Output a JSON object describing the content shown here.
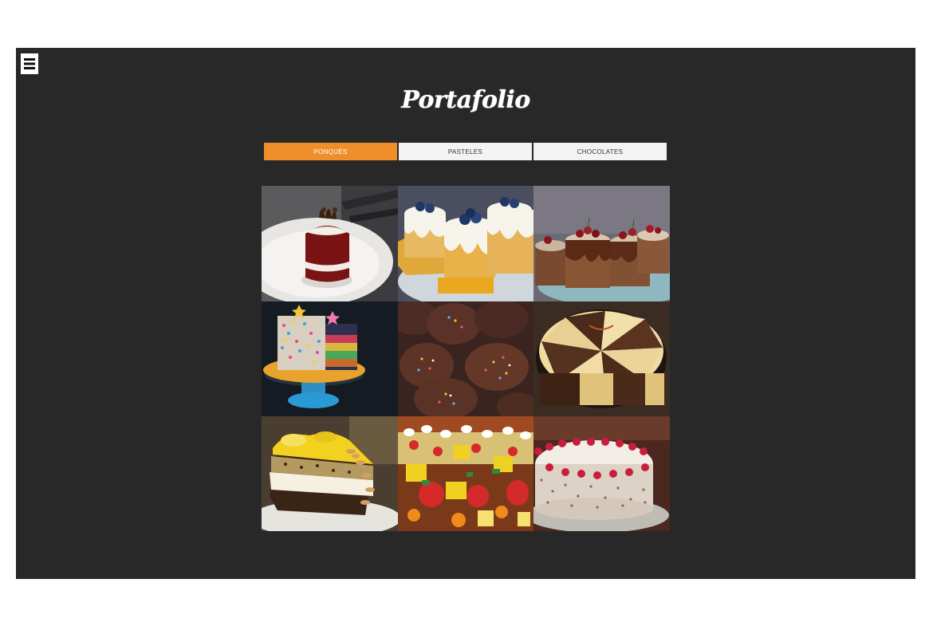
{
  "menu": {
    "icon": "hamburger-menu-icon"
  },
  "page": {
    "title": "Portafolio"
  },
  "tabs": [
    {
      "label": "PONQUÉS",
      "active": true
    },
    {
      "label": "PASTELES",
      "active": false
    },
    {
      "label": "CHOCOLATES",
      "active": false
    }
  ],
  "colors": {
    "stage": "#282828",
    "accent": "#ef8f2c",
    "tab_bg": "#f3f3f3"
  },
  "gallery": [
    {
      "subject": "red-velvet-cupcake-photo"
    },
    {
      "subject": "blueberry-mini-cakes-photo"
    },
    {
      "subject": "cherry-chocolate-mini-cakes-photo"
    },
    {
      "subject": "rainbow-sprinkle-cake-photo"
    },
    {
      "subject": "chocolate-cupcakes-sprinkles-photo"
    },
    {
      "subject": "cheesecake-slices-photo"
    },
    {
      "subject": "lemon-almond-cake-slice-photo"
    },
    {
      "subject": "fruit-petit-fours-photo"
    },
    {
      "subject": "raspberry-cream-cake-photo"
    }
  ]
}
